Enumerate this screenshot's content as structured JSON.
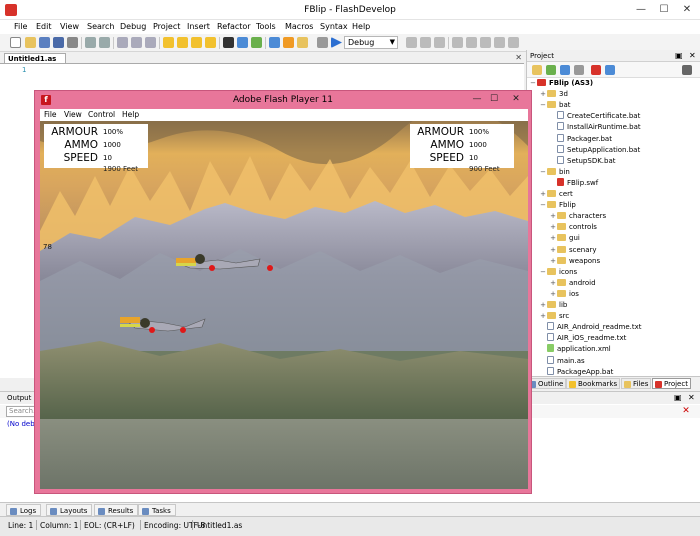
{
  "window": {
    "title": "FBlip - FlashDevelop",
    "controls": {
      "minimize": "—",
      "maximize": "☐",
      "close": "✕"
    }
  },
  "menubar": [
    "File",
    "Edit",
    "View",
    "Search",
    "Debug",
    "Project",
    "Insert",
    "Refactor",
    "Tools",
    "Macros",
    "Syntax",
    "Help"
  ],
  "toolbar": {
    "configuration": "Debug"
  },
  "editor": {
    "tab_label": "Untitled1.as",
    "line_number": "1"
  },
  "project_panel": {
    "title": "Project",
    "root": "FBlip (AS3)",
    "tree": [
      {
        "label": "3d",
        "type": "folder",
        "level": 1,
        "expander": "+"
      },
      {
        "label": "bat",
        "type": "folder",
        "level": 1,
        "expander": "−"
      },
      {
        "label": "CreateCertificate.bat",
        "type": "file",
        "level": 2
      },
      {
        "label": "InstallAirRuntime.bat",
        "type": "file",
        "level": 2
      },
      {
        "label": "Packager.bat",
        "type": "file",
        "level": 2
      },
      {
        "label": "SetupApplication.bat",
        "type": "file",
        "level": 2
      },
      {
        "label": "SetupSDK.bat",
        "type": "file",
        "level": 2
      },
      {
        "label": "bin",
        "type": "folder",
        "level": 1,
        "expander": "−"
      },
      {
        "label": "FBlip.swf",
        "type": "swf",
        "level": 2
      },
      {
        "label": "cert",
        "type": "folder",
        "level": 1,
        "expander": "+"
      },
      {
        "label": "Fblip",
        "type": "folder",
        "level": 1,
        "expander": "−"
      },
      {
        "label": "characters",
        "type": "folder",
        "level": 2,
        "expander": "+"
      },
      {
        "label": "controls",
        "type": "folder",
        "level": 2,
        "expander": "+"
      },
      {
        "label": "gui",
        "type": "folder",
        "level": 2,
        "expander": "+"
      },
      {
        "label": "scenary",
        "type": "folder",
        "level": 2,
        "expander": "+"
      },
      {
        "label": "weapons",
        "type": "folder",
        "level": 2,
        "expander": "+"
      },
      {
        "label": "icons",
        "type": "folder",
        "level": 1,
        "expander": "−"
      },
      {
        "label": "android",
        "type": "folder",
        "level": 2,
        "expander": "+"
      },
      {
        "label": "ios",
        "type": "folder",
        "level": 2,
        "expander": "+"
      },
      {
        "label": "lib",
        "type": "folder",
        "level": 1,
        "expander": "+"
      },
      {
        "label": "src",
        "type": "folder",
        "level": 1,
        "expander": "+"
      },
      {
        "label": "AIR_Android_readme.txt",
        "type": "file",
        "level": 1
      },
      {
        "label": "AIR_iOS_readme.txt",
        "type": "file",
        "level": 1
      },
      {
        "label": "application.xml",
        "type": "xml",
        "level": 1
      },
      {
        "label": "main.as",
        "type": "file",
        "level": 1
      },
      {
        "label": "PackageApp.bat",
        "type": "file",
        "level": 1
      }
    ],
    "tabs": [
      "Outline",
      "Bookmarks",
      "Files",
      "Project"
    ]
  },
  "output_panel": {
    "title": "Output",
    "search_placeholder": "Search...",
    "text": "(No deb"
  },
  "bottom_tabs": [
    "Logs",
    "Layouts",
    "Results",
    "Tasks"
  ],
  "statusbar": {
    "line": "Line: 1",
    "column": "Column: 1",
    "eol": "EOL: (CR+LF)",
    "encoding": "Encoding: UTF-8",
    "file": "Untitled1.as"
  },
  "flash_player": {
    "title": "Adobe Flash Player 11",
    "menu": [
      "File",
      "View",
      "Control",
      "Help"
    ],
    "hud_left": {
      "armour_label": "ARMOUR",
      "armour_value": "100%",
      "ammo_label": "AMMO",
      "ammo_value": "1000",
      "speed_label": "SPEED",
      "speed_value": "10",
      "altitude": "1900 Feet"
    },
    "hud_right": {
      "armour_label": "ARMOUR",
      "armour_value": "100%",
      "ammo_label": "AMMO",
      "ammo_value": "1000",
      "speed_label": "SPEED",
      "speed_value": "10",
      "altitude": "900 Feet"
    },
    "side_readout": "78"
  }
}
